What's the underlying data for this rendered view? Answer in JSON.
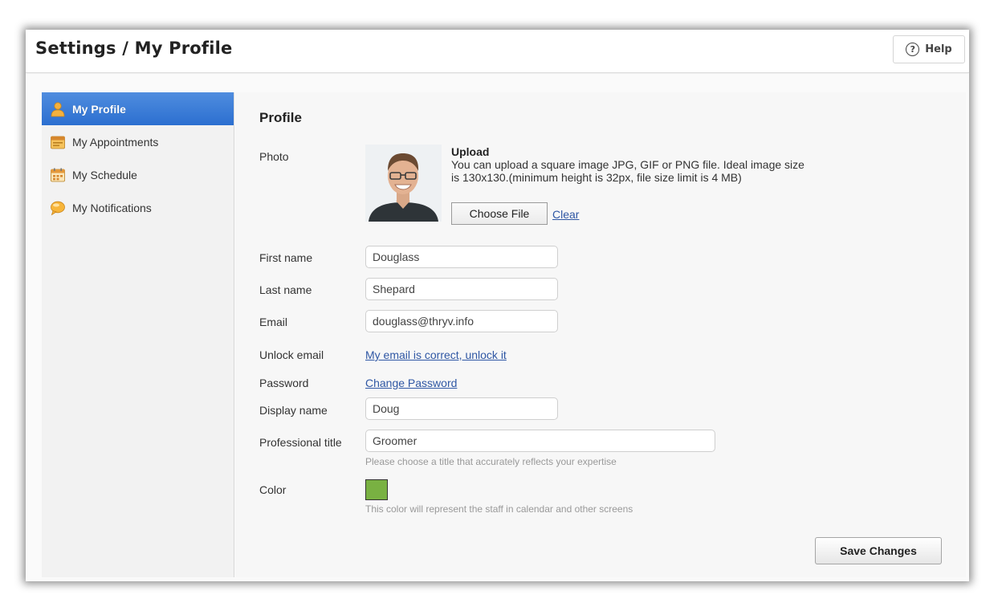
{
  "header": {
    "title": "Settings / My Profile",
    "help_label": "Help",
    "help_icon_glyph": "?"
  },
  "sidebar": {
    "active_color": "#3a7bd5",
    "items": [
      {
        "label": "My Profile",
        "icon": "user-icon",
        "active": true
      },
      {
        "label": "My Appointments",
        "icon": "appointments-icon",
        "active": false
      },
      {
        "label": "My Schedule",
        "icon": "calendar-icon",
        "active": false
      },
      {
        "label": "My Notifications",
        "icon": "notification-bubble-icon",
        "active": false
      }
    ]
  },
  "profile": {
    "section_title": "Profile",
    "photo": {
      "label": "Photo",
      "upload_title": "Upload",
      "upload_desc": "You can upload a square image JPG, GIF or PNG file. Ideal image size is 130x130.(minimum height is 32px, file size limit is 4 MB)",
      "choose_label": "Choose File",
      "clear_label": "Clear"
    },
    "first_name": {
      "label": "First name",
      "value": "Douglass"
    },
    "last_name": {
      "label": "Last name",
      "value": "Shepard"
    },
    "email": {
      "label": "Email",
      "value": "douglass@thryv.info"
    },
    "unlock_email": {
      "label": "Unlock email",
      "link": "My email is correct, unlock it"
    },
    "password": {
      "label": "Password",
      "link": "Change Password"
    },
    "display_name": {
      "label": "Display name",
      "value": "Doug"
    },
    "professional_title": {
      "label": "Professional title",
      "value": "Groomer",
      "hint": "Please choose a title that accurately reflects your expertise"
    },
    "color": {
      "label": "Color",
      "value": "#79b142",
      "hint": "This color will represent the staff in calendar and other screens"
    },
    "save_label": "Save Changes"
  }
}
